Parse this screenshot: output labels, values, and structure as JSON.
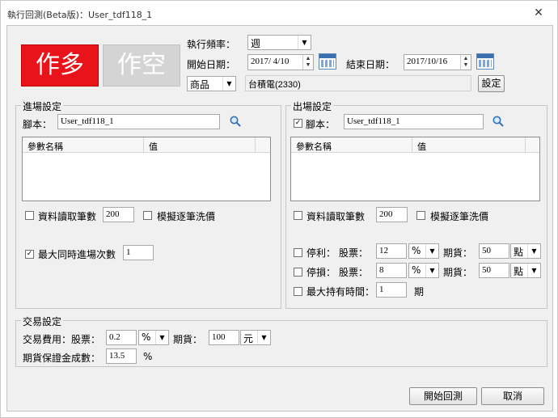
{
  "window": {
    "title": "執行回測(Beta版)：User_tdf118_1",
    "close": "✕"
  },
  "top": {
    "long_button": "作多",
    "short_button": "作空",
    "freq_label": "執行頻率：",
    "freq_value": "週",
    "start_label": "開始日期：",
    "start_value": "2017/ 4/10",
    "end_label": "結束日期：",
    "end_value": "2017/10/16",
    "product_type": "商品",
    "product_value": "台積電(2330)",
    "settings_button": "設定"
  },
  "entry": {
    "title": "進場設定",
    "script_label": "腳本：",
    "script_value": "User_tdf118_1",
    "col_param": "參數名稱",
    "col_value": "值",
    "read_bars_label": "資料讀取筆數",
    "read_bars_value": "200",
    "simulate_label": "模擬逐筆洗價",
    "max_entries_label": "最大同時進場次數",
    "max_entries_value": "1"
  },
  "exit": {
    "title": "出場設定",
    "script_label": "腳本：",
    "script_value": "User_tdf118_1",
    "col_param": "參數名稱",
    "col_value": "值",
    "read_bars_label": "資料讀取筆數",
    "read_bars_value": "200",
    "simulate_label": "模擬逐筆洗價",
    "take_profit_label": "停利：",
    "stop_loss_label": "停損：",
    "stock_label": "股票：",
    "futures_label": "期貨：",
    "tp_stock_value": "12",
    "tp_stock_unit": "%",
    "tp_fut_value": "50",
    "tp_fut_unit": "點",
    "sl_stock_value": "8",
    "sl_stock_unit": "%",
    "sl_fut_value": "50",
    "sl_fut_unit": "點",
    "max_hold_label": "最大持有時間：",
    "max_hold_value": "1",
    "max_hold_unit": "期"
  },
  "trade": {
    "title": "交易設定",
    "fee_label": "交易費用：股票：",
    "fee_stock_value": "0.2",
    "fee_stock_unit": "%",
    "fee_fut_label": "期貨：",
    "fee_fut_value": "100",
    "fee_fut_unit": "元",
    "margin_label": "期貨保證金成數：",
    "margin_value": "13.5",
    "margin_unit": "%"
  },
  "footer": {
    "start_button": "開始回測",
    "cancel_button": "取消"
  },
  "colors": {
    "long_red": "#e8141a",
    "short_disabled": "#d4d4d4",
    "calendar_blue": "#3a6fb0"
  },
  "check_mark": "✓"
}
